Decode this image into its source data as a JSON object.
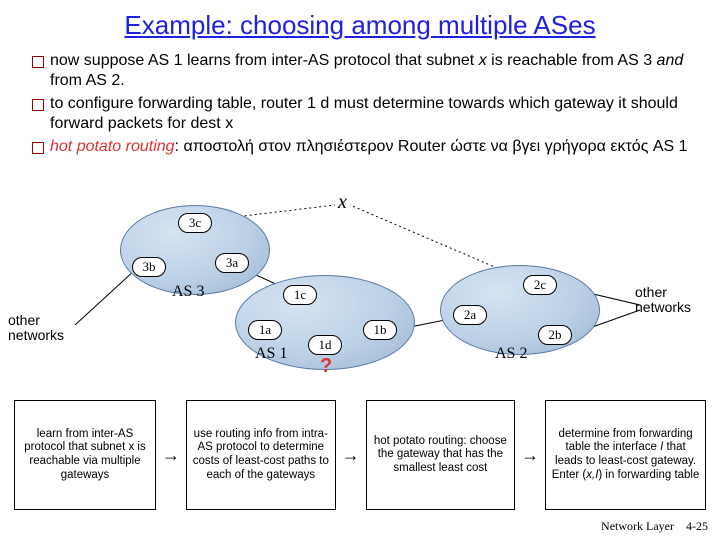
{
  "title": "Example: choosing among multiple ASes",
  "bullets": {
    "b1a": "now suppose AS 1 learns from inter-AS protocol that subnet ",
    "b1x": "x",
    "b1b": " is reachable from AS 3 ",
    "b1and": "and",
    "b1c": " from AS 2.",
    "b2": "to configure forwarding table, router 1 d must determine towards which gateway it should forward packets for dest x",
    "b3a": "hot potato routing",
    "b3b": ": αποστολή στον πλησιέστερον Router ώστε να βγει γρήγορα εκτός AS 1"
  },
  "diagram": {
    "x_label": "x",
    "routers": {
      "r3c": "3c",
      "r3b": "3b",
      "r3a": "3a",
      "r1c": "1c",
      "r1a": "1a",
      "r1d": "1d",
      "r1b": "1b",
      "r2a": "2a",
      "r2c": "2c",
      "r2b": "2b"
    },
    "as": {
      "as3": "AS 3",
      "as1": "AS 1",
      "as2": "AS 2"
    },
    "other_left": "other networks",
    "other_right": "other networks",
    "qmark": "?"
  },
  "steps": {
    "s1": "learn from inter-AS protocol that subnet x is reachable via multiple gateways",
    "s2": "use routing info from intra-AS protocol to determine costs of least-cost paths to each of the gateways",
    "s3": "hot potato routing: choose the gateway that has the smallest least cost",
    "s4a": "determine from forwarding table the interface ",
    "s4I": "I",
    "s4b": " that leads to least-cost gateway. Enter (",
    "s4x": "x,I",
    "s4c": ") in forwarding table"
  },
  "footer": {
    "label": "Network Layer",
    "page": "4-25"
  }
}
